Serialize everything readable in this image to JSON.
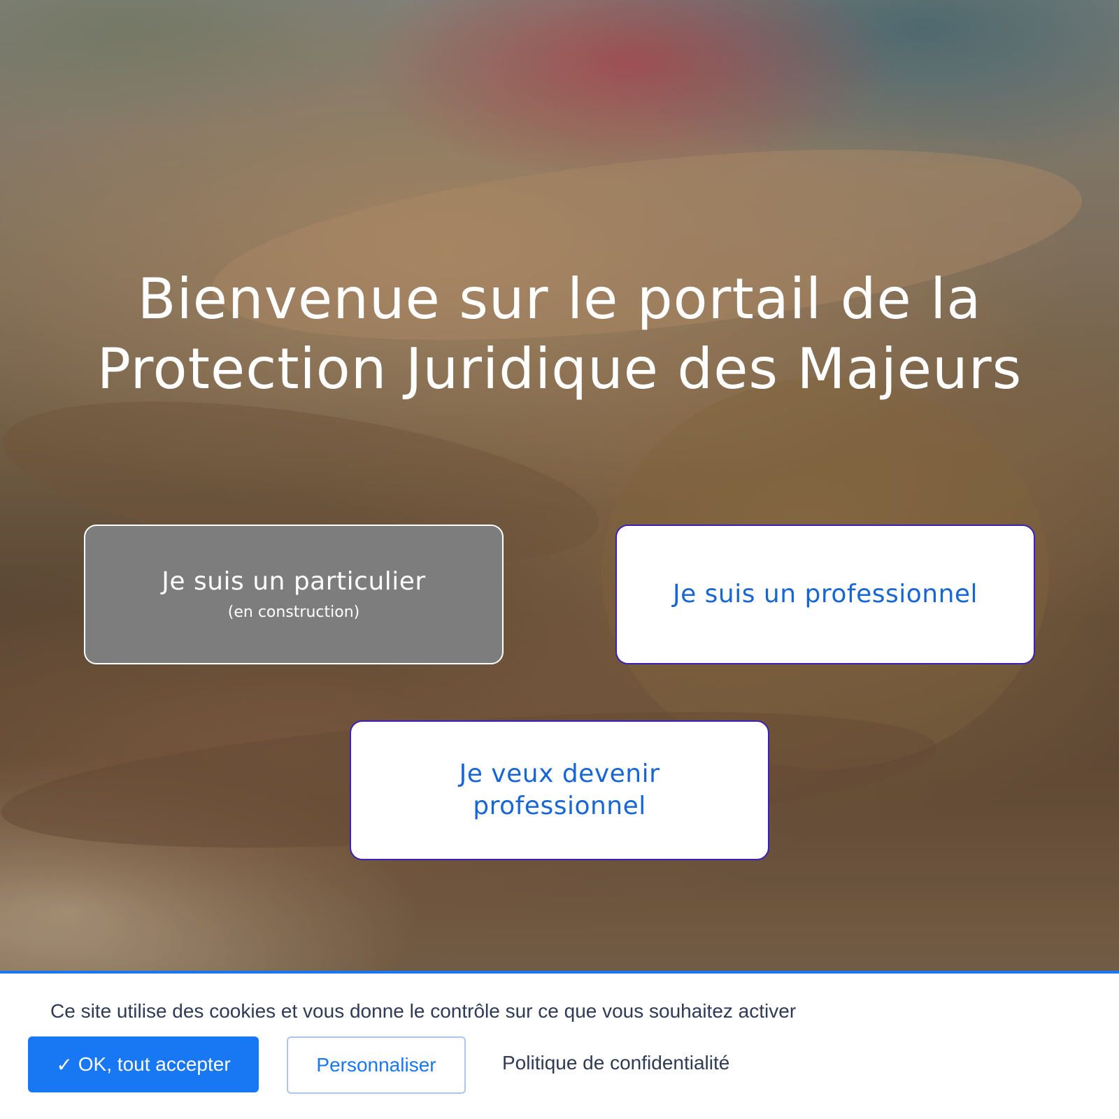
{
  "hero": {
    "title_line1": "Bienvenue sur le portail de la",
    "title_line2": "Protection Juridique des Majeurs"
  },
  "choices": {
    "particulier": {
      "label": "Je suis un particulier",
      "note": "(en construction)"
    },
    "professionnel": {
      "label": "Je suis un professionnel"
    },
    "devenir": {
      "label": "Je veux devenir professionnel"
    }
  },
  "cookie_banner": {
    "message": "Ce site utilise des cookies et vous donne le contrôle sur ce que vous souhaitez activer",
    "accept_icon": "✓",
    "accept_label": "OK, tout accepter",
    "customize_label": "Personnaliser",
    "privacy_label": "Politique de confidentialité"
  },
  "colors": {
    "accent": "#1877f2",
    "choice_border": "#3a1fb8",
    "choice_text": "#1766d6",
    "banner_text": "#2f3a56"
  }
}
